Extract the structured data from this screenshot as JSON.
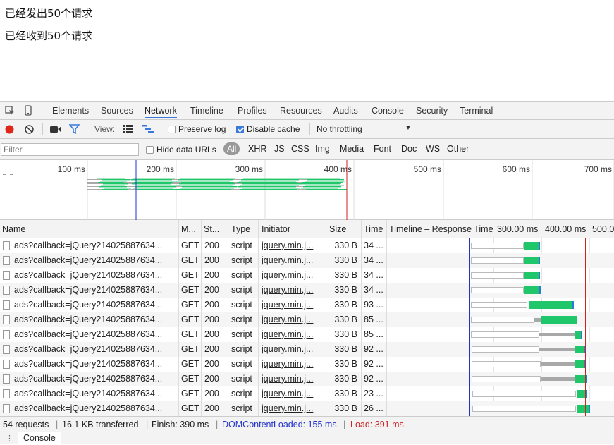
{
  "page": {
    "line1": "已经发出50个请求",
    "line2": "已经收到50个请求"
  },
  "tabs": [
    "Elements",
    "Sources",
    "Network",
    "Timeline",
    "Profiles",
    "Resources",
    "Audits",
    "Console",
    "Security",
    "Terminal"
  ],
  "active_tab": "Network",
  "toolbar": {
    "view_label": "View:",
    "preserve_log": "Preserve log",
    "disable_cache": "Disable cache",
    "throttling": "No throttling"
  },
  "filter": {
    "placeholder": "Filter",
    "hide_data_urls": "Hide data URLs",
    "types": [
      "All",
      "XHR",
      "JS",
      "CSS",
      "Img",
      "Media",
      "Font",
      "Doc",
      "WS",
      "Other"
    ]
  },
  "overview": {
    "ticks": [
      "100 ms",
      "200 ms",
      "300 ms",
      "400 ms",
      "500 ms",
      "600 ms",
      "700 ms"
    ]
  },
  "columns": {
    "name": "Name",
    "method": "M...",
    "status": "St...",
    "type": "Type",
    "initiator": "Initiator",
    "size": "Size",
    "time": "Time",
    "timeline": "Timeline – Response Time",
    "tl_ticks": [
      "300.00 ms",
      "400.00 ms",
      "500.0"
    ]
  },
  "rows": [
    {
      "name": "ads?callback=jQuery214025887634...",
      "method": "GET",
      "status": "200",
      "type": "script",
      "initiator": "jquery.min.j...",
      "size": "330 B",
      "time": "34 ..."
    },
    {
      "name": "ads?callback=jQuery214025887634...",
      "method": "GET",
      "status": "200",
      "type": "script",
      "initiator": "jquery.min.j...",
      "size": "330 B",
      "time": "34 ..."
    },
    {
      "name": "ads?callback=jQuery214025887634...",
      "method": "GET",
      "status": "200",
      "type": "script",
      "initiator": "jquery.min.j...",
      "size": "330 B",
      "time": "34 ..."
    },
    {
      "name": "ads?callback=jQuery214025887634...",
      "method": "GET",
      "status": "200",
      "type": "script",
      "initiator": "jquery.min.j...",
      "size": "330 B",
      "time": "34 ..."
    },
    {
      "name": "ads?callback=jQuery214025887634...",
      "method": "GET",
      "status": "200",
      "type": "script",
      "initiator": "jquery.min.j...",
      "size": "330 B",
      "time": "93 ..."
    },
    {
      "name": "ads?callback=jQuery214025887634...",
      "method": "GET",
      "status": "200",
      "type": "script",
      "initiator": "jquery.min.j...",
      "size": "330 B",
      "time": "85 ..."
    },
    {
      "name": "ads?callback=jQuery214025887634...",
      "method": "GET",
      "status": "200",
      "type": "script",
      "initiator": "jquery.min.j...",
      "size": "330 B",
      "time": "85 ..."
    },
    {
      "name": "ads?callback=jQuery214025887634...",
      "method": "GET",
      "status": "200",
      "type": "script",
      "initiator": "jquery.min.j...",
      "size": "330 B",
      "time": "92 ..."
    },
    {
      "name": "ads?callback=jQuery214025887634...",
      "method": "GET",
      "status": "200",
      "type": "script",
      "initiator": "jquery.min.j...",
      "size": "330 B",
      "time": "92 ..."
    },
    {
      "name": "ads?callback=jQuery214025887634...",
      "method": "GET",
      "status": "200",
      "type": "script",
      "initiator": "jquery.min.j...",
      "size": "330 B",
      "time": "92 ..."
    },
    {
      "name": "ads?callback=jQuery214025887634...",
      "method": "GET",
      "status": "200",
      "type": "script",
      "initiator": "jquery.min.j...",
      "size": "330 B",
      "time": "23 ..."
    },
    {
      "name": "ads?callback=jQuery214025887634...",
      "method": "GET",
      "status": "200",
      "type": "script",
      "initiator": "jquery.min.j...",
      "size": "330 B",
      "time": "26 ..."
    }
  ],
  "status": {
    "requests": "54 requests",
    "transferred": "16.1 KB transferred",
    "finish": "Finish: 390 ms",
    "dcl": "DOMContentLoaded: 155 ms",
    "load": "Load: 391 ms"
  },
  "drawer": {
    "console_tab": "Console"
  },
  "colors": {
    "accent": "#3879d9",
    "receive": "#1fc76a",
    "waiting": "#a8a8a8",
    "dcl": "#2233cc",
    "load": "#cc2222"
  }
}
